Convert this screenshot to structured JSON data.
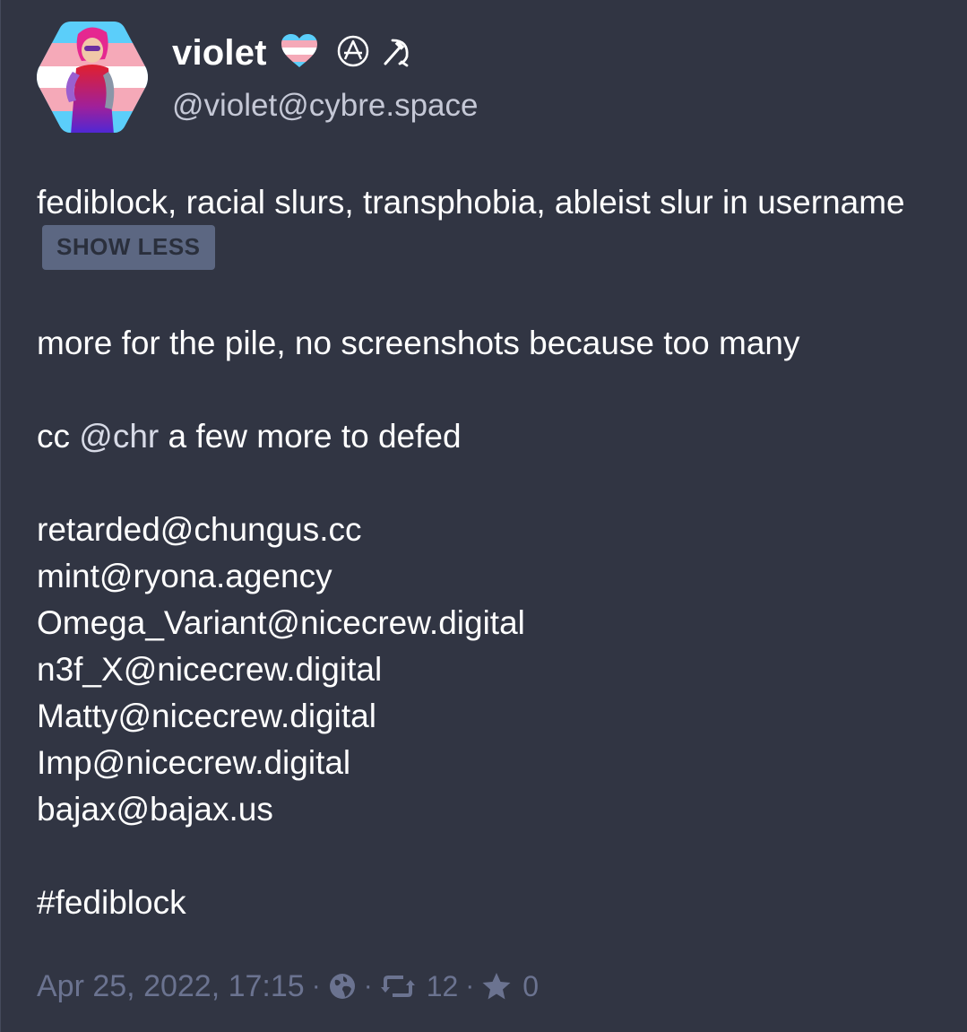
{
  "account": {
    "display_name": "violet",
    "emoji_icons": [
      "trans-heart-icon",
      "anarchy-icon",
      "hammer-sickle-icon"
    ],
    "acct": "@violet@cybre.space"
  },
  "status": {
    "spoiler_text": "fediblock, racial slurs, transphobia, ableist slur in username",
    "show_less_label": "SHOW LESS",
    "intro": "more for the pile, no screenshots because too many",
    "cc_prefix": "cc",
    "mention": "@chr",
    "cc_suffix": "a few more to defed",
    "accounts": [
      "retarded@chungus.cc",
      "mint@ryona.agency",
      "Omega_Variant@nicecrew.digital",
      "n3f_X@nicecrew.digital",
      "Matty@nicecrew.digital",
      "Imp@nicecrew.digital",
      "bajax@bajax.us"
    ],
    "hashtag": "#fediblock"
  },
  "footer": {
    "timestamp": "Apr 25, 2022, 17:15",
    "separator": "·",
    "visibility_icon": "globe-icon",
    "boost_icon": "retweet-icon",
    "boost_count": "12",
    "favourite_icon": "star-icon",
    "favourite_count": "0"
  },
  "colors": {
    "background": "#313543",
    "text": "#ffffff",
    "secondary_text": "#c5c8d6",
    "muted": "#6b7390",
    "button_bg": "#5c6782"
  }
}
